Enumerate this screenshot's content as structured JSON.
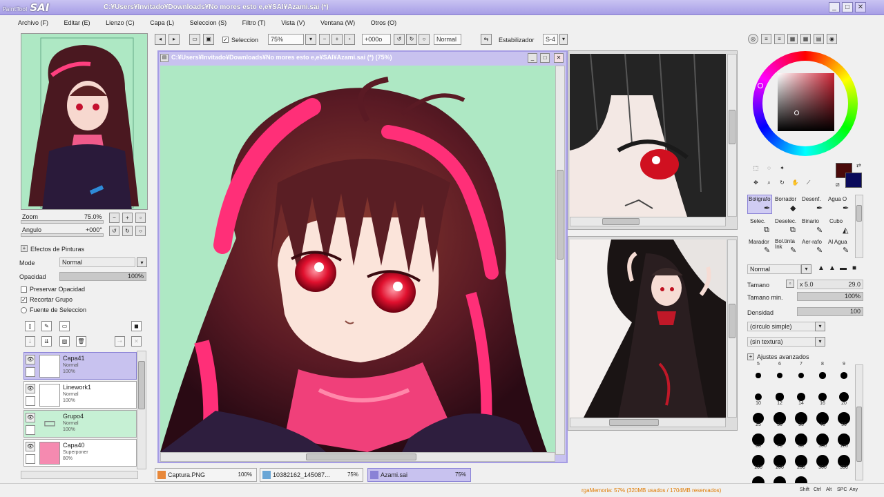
{
  "app": {
    "logo": "SAI",
    "logo_small": "PaintTool",
    "title": "C:¥Users¥Invitado¥Downloads¥No mores esto e,e¥SAI¥Azami.sai (*)"
  },
  "window_controls": {
    "minimize": "_",
    "maximize": "□",
    "close": "✕"
  },
  "menu": [
    "Archivo (F)",
    "Editar (E)",
    "Lienzo (C)",
    "Capa (L)",
    "Seleccion (S)",
    "Filtro (T)",
    "Vista (V)",
    "Ventana (W)",
    "Otros (O)"
  ],
  "toolbar": {
    "selection_label": "Seleccion",
    "zoom": "75%",
    "angle": "+000o",
    "blend": "Normal",
    "stabilizer_label": "Estabilizador",
    "stabilizer_value": "S-4"
  },
  "navigator": {
    "zoom_label": "Zoom",
    "zoom_value": "75.0%",
    "angle_label": "Angulo",
    "angle_value": "+000°"
  },
  "layer_panel": {
    "effects_label": "Efectos de Pinturas",
    "mode_label": "Mode",
    "mode_value": "Normal",
    "opacity_label": "Opacidad",
    "opacity_value": "100%",
    "opacity_fraction": 1.0,
    "preserve_opacity": "Preservar Opacidad",
    "clip_group": "Recortar Grupo",
    "selection_source": "Fuente de Seleccion"
  },
  "layers": [
    {
      "name": "Capa41",
      "mode": "Normal",
      "opacity": "100%",
      "selected": true
    },
    {
      "name": "Linework1",
      "mode": "Normal",
      "opacity": "100%",
      "selected": false
    },
    {
      "name": "Grupo4",
      "mode": "Normal",
      "opacity": "100%",
      "selected": false
    },
    {
      "name": "Capa40",
      "mode": "Superponer",
      "opacity": "80%",
      "selected": false
    }
  ],
  "document": {
    "title": "C:¥Users¥Invitado¥Downloads¥No mores esto e,e¥SAI¥Azami.sai (*) (75%)"
  },
  "tabs": [
    {
      "name": "Captura.PNG",
      "zoom": "100%"
    },
    {
      "name": "10382162_145087...",
      "zoom": "75%"
    },
    {
      "name": "Azami.sai",
      "zoom": "75%"
    }
  ],
  "tools": [
    {
      "name": "Selec. Lazo",
      "row": 0
    },
    {
      "name": "Lapiz",
      "row": 0
    }
  ],
  "brushes": [
    "Boligrafo",
    "Borrador",
    "Desenf.",
    "Agua O",
    "Selec.",
    "Deselec.",
    "Binario",
    "Cubo",
    "Marador",
    "Bol.tinta Ink",
    "Aer-rafo",
    "Al Agua"
  ],
  "brush_settings": {
    "blend": "Normal",
    "size_label": "Tamano",
    "size_multiplier": "x 5.0",
    "size_value": "29.0",
    "min_size_label": "Tamano min.",
    "min_size_value": "100%",
    "density_label": "Densidad",
    "density_value": "100",
    "shape": "(circulo simple)",
    "texture": "(sin textura)",
    "advanced": "Ajustes avanzados"
  },
  "brush_sizes": [
    "5",
    "6",
    "7",
    "8",
    "9",
    "10",
    "12",
    "14",
    "16",
    "20",
    "25",
    "30",
    "35",
    "40",
    "50",
    "60",
    "70",
    "80",
    "100",
    "120",
    "160",
    "200",
    "250",
    "300",
    "350",
    "400",
    "450",
    "500"
  ],
  "colors": {
    "primary": "#4a0a0a",
    "secondary": "#0a0a5a",
    "accent": "#a59ce4",
    "picker": "#cc2233"
  },
  "status": {
    "memory": "rgaMemoria: 57% (320MB usados / 1704MB reservados)",
    "keys": [
      "Shift",
      "Ctrl",
      "Alt",
      "SPC",
      "Any"
    ]
  }
}
